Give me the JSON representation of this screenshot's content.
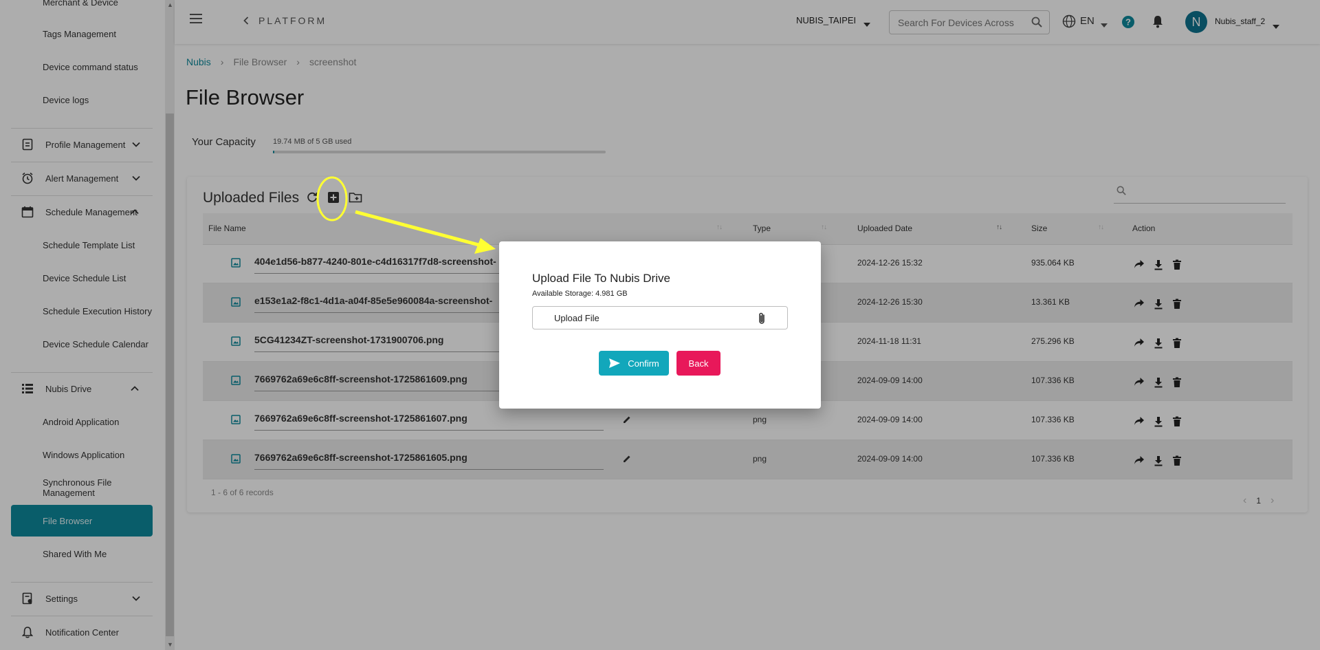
{
  "colors": {
    "accent": "#0e8a9c",
    "confirm": "#12a7bb",
    "back": "#e8185a",
    "annotation": "#ffff33"
  },
  "sidebar": {
    "items": [
      {
        "label": "Merchant & Device",
        "type": "sub"
      },
      {
        "label": "Tags Management",
        "type": "sub"
      },
      {
        "label": "Device command status",
        "type": "sub"
      },
      {
        "label": "Device logs",
        "type": "sub"
      },
      {
        "label": "Profile Management",
        "type": "group",
        "icon": "profile-icon",
        "expanded": false
      },
      {
        "label": "Alert Management",
        "type": "group",
        "icon": "alarm-clock-icon",
        "expanded": false
      },
      {
        "label": "Schedule Management",
        "type": "group",
        "icon": "calendar-icon",
        "expanded": true
      },
      {
        "label": "Schedule Template List",
        "type": "sub"
      },
      {
        "label": "Device Schedule List",
        "type": "sub"
      },
      {
        "label": "Schedule Execution History",
        "type": "sub"
      },
      {
        "label": "Device Schedule Calendar",
        "type": "sub"
      },
      {
        "label": "Nubis Drive",
        "type": "group",
        "icon": "list-icon",
        "expanded": true
      },
      {
        "label": "Android Application",
        "type": "sub"
      },
      {
        "label": "Windows Application",
        "type": "sub"
      },
      {
        "label": "Synchronous File Management",
        "type": "sub"
      },
      {
        "label": "File Browser",
        "type": "sub",
        "active": true
      },
      {
        "label": "Shared With Me",
        "type": "sub"
      },
      {
        "label": "Settings",
        "type": "group",
        "icon": "settings-doc-icon",
        "expanded": false
      },
      {
        "label": "Notification Center",
        "type": "group",
        "icon": "bell-icon"
      }
    ]
  },
  "header": {
    "platform": "PLATFORM",
    "tenant": "NUBIS_TAIPEI",
    "search_placeholder": "Search For Devices Across",
    "language": "EN",
    "avatar_initial": "N",
    "username": "Nubis_staff_2"
  },
  "breadcrumb": [
    "Nubis",
    "File Browser",
    "screenshot"
  ],
  "page_title": "File Browser",
  "capacity": {
    "label": "Your Capacity",
    "text": "19.74 MB of 5 GB used",
    "fraction_used": 0.004
  },
  "files": {
    "title": "Uploaded Files",
    "columns": [
      "File Name",
      "Type",
      "Uploaded Date",
      "Size",
      "Action"
    ],
    "rows": [
      {
        "name": "404e1d56-b877-4240-801e-c4d16317f7d8-screenshot-",
        "type": "",
        "date": "2024-12-26 15:32",
        "size": "935.064 KB"
      },
      {
        "name": "e153e1a2-f8c1-4d1a-a04f-85e5e960084a-screenshot-",
        "type": "",
        "date": "2024-12-26 15:30",
        "size": "13.361 KB"
      },
      {
        "name": "5CG41234ZT-screenshot-1731900706.png",
        "type": "",
        "date": "2024-11-18 11:31",
        "size": "275.296 KB"
      },
      {
        "name": "7669762a69e6c8ff-screenshot-1725861609.png",
        "type": "",
        "date": "2024-09-09 14:00",
        "size": "107.336 KB"
      },
      {
        "name": "7669762a69e6c8ff-screenshot-1725861607.png",
        "type": "png",
        "date": "2024-09-09 14:00",
        "size": "107.336 KB"
      },
      {
        "name": "7669762a69e6c8ff-screenshot-1725861605.png",
        "type": "png",
        "date": "2024-09-09 14:00",
        "size": "107.336 KB"
      }
    ],
    "records": "1 - 6 of 6 records",
    "page": "1"
  },
  "modal": {
    "title": "Upload File To Nubis Drive",
    "storage": "Available Storage: 4.981 GB",
    "upload_label": "Upload File",
    "confirm": "Confirm",
    "back": "Back"
  }
}
